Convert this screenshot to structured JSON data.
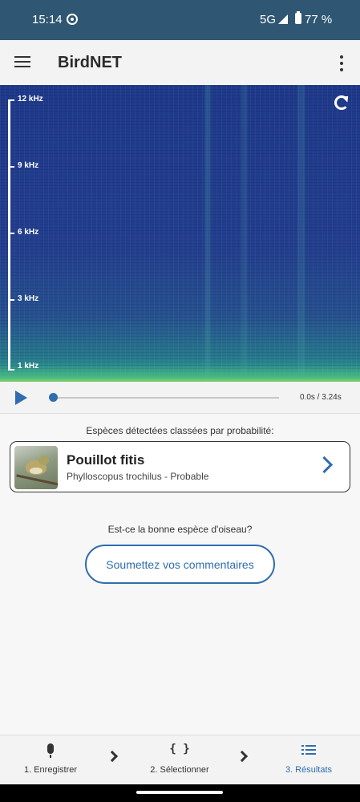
{
  "status_bar": {
    "time": "15:14",
    "network": "5G",
    "battery": "77 %"
  },
  "app_bar": {
    "title": "BirdNET"
  },
  "spectrogram": {
    "freq_labels": [
      "12 kHz",
      "9 kHz",
      "6 kHz",
      "3 kHz",
      "1 kHz"
    ]
  },
  "player": {
    "time": "0.0s / 3.24s",
    "progress": 0
  },
  "results": {
    "header": "Espèces détectées classées par probabilité:",
    "species": [
      {
        "name": "Pouillot fitis",
        "subtitle": "Phylloscopus trochilus - Probable"
      }
    ],
    "question": "Est-ce la bonne espèce d'oiseau?",
    "feedback_button": "Soumettez vos commentaires"
  },
  "bottom_nav": {
    "items": [
      {
        "label": "1. Enregistrer",
        "icon": "mic-icon"
      },
      {
        "label": "2. Sélectionner",
        "icon": "braces-icon",
        "glyph": "{ }"
      },
      {
        "label": "3. Résultats",
        "icon": "list-icon",
        "active": true
      }
    ]
  },
  "colors": {
    "accent": "#2f6dae",
    "status_bar": "#2f5672"
  }
}
